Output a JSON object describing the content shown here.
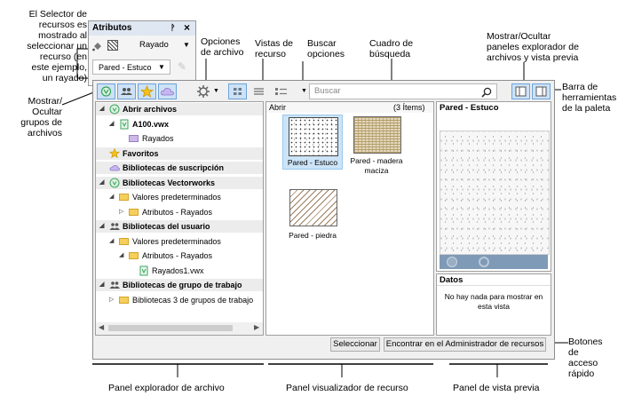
{
  "callouts": {
    "selector": [
      "El Selector de",
      "recursos es",
      "mostrado al",
      "seleccionar un",
      "recurso (en",
      "este ejemplo,",
      "un rayado)"
    ],
    "toggle_groups": [
      "Mostrar/",
      "Ocultar",
      "grupos de",
      "archivos"
    ],
    "file_options": [
      "Opciones",
      "de archivo"
    ],
    "resource_views": [
      "Vistas de",
      "recurso"
    ],
    "search_options": [
      "Buscar",
      "opciones"
    ],
    "search_box": [
      "Cuadro de",
      "búsqueda"
    ],
    "toggle_panels": [
      "Mostrar/Ocultar",
      "paneles explorador de",
      "archivos y vista previa"
    ],
    "toolbar": [
      "Barra de",
      "herramientas",
      "de la paleta"
    ],
    "quick_buttons": [
      "Botones",
      "de",
      "acceso",
      "rápido"
    ],
    "bottom_explorer": "Panel explorador de archivo",
    "bottom_viewer": "Panel visualizador de recurso",
    "bottom_preview": "Panel de vista previa"
  },
  "attributes_palette": {
    "title": "Atributos",
    "pin_glyph": "ᚹ",
    "close_glyph": "×",
    "fill_label": "Rayado",
    "resource_label": "Pared - Estuco"
  },
  "toolbar": {
    "search_placeholder": "Buscar"
  },
  "tree": [
    {
      "label": "Abrir archivos",
      "level": 0,
      "bold": true,
      "sec": true,
      "tri": "◢",
      "icon": "vw-icon"
    },
    {
      "label": "A100.vwx",
      "level": 1,
      "bold": true,
      "sec": false,
      "tri": "◢",
      "icon": "vw-file-icon"
    },
    {
      "label": "Rayados",
      "level": 2,
      "bold": false,
      "sec": false,
      "tri": "",
      "icon": "folder-purple"
    },
    {
      "label": "Favoritos",
      "level": 0,
      "bold": true,
      "sec": true,
      "tri": "",
      "icon": "star-icon"
    },
    {
      "label": "Bibliotecas de suscripción",
      "level": 0,
      "bold": true,
      "sec": true,
      "tri": "",
      "icon": "cloud-icon"
    },
    {
      "label": "Bibliotecas Vectorworks",
      "level": 0,
      "bold": true,
      "sec": true,
      "tri": "◢",
      "icon": "vw-icon"
    },
    {
      "label": "Valores predeterminados",
      "level": 1,
      "bold": false,
      "sec": false,
      "tri": "◢",
      "icon": "folder"
    },
    {
      "label": "Atributos - Rayados",
      "level": 2,
      "bold": false,
      "sec": false,
      "tri": "▷",
      "icon": "folder"
    },
    {
      "label": "Bibliotecas del usuario",
      "level": 0,
      "bold": true,
      "sec": true,
      "tri": "◢",
      "icon": "users-icon"
    },
    {
      "label": "Valores predeterminados",
      "level": 1,
      "bold": false,
      "sec": false,
      "tri": "◢",
      "icon": "folder"
    },
    {
      "label": "Atributos - Rayados",
      "level": 2,
      "bold": false,
      "sec": false,
      "tri": "◢",
      "icon": "folder"
    },
    {
      "label": "Rayados1.vwx",
      "level": 3,
      "bold": false,
      "sec": false,
      "tri": "",
      "icon": "vw-file-icon"
    },
    {
      "label": "Bibliotecas de grupo de trabajo",
      "level": 0,
      "bold": true,
      "sec": true,
      "tri": "◢",
      "icon": "users-icon"
    },
    {
      "label": "Bibliotecas 3 de grupos de trabajo",
      "level": 1,
      "bold": false,
      "sec": false,
      "tri": "▷",
      "icon": "folder"
    }
  ],
  "viewer": {
    "header": "Abrir",
    "count": "(3 Ítems)",
    "items": [
      {
        "label": "Pared - Estuco",
        "label2": "",
        "pattern": "stucco",
        "selected": true
      },
      {
        "label": "Pared - madera",
        "label2": "maciza",
        "pattern": "wood",
        "selected": false
      },
      {
        "label": "Pared - piedra",
        "label2": "",
        "pattern": "hatch",
        "selected": false
      }
    ]
  },
  "preview": {
    "title": "Pared - Estuco",
    "data_title": "Datos",
    "data_empty": "No hay nada para mostrar en esta vista"
  },
  "buttons": {
    "select": "Seleccionar",
    "find": "Encontrar en el Administrador de recursos"
  },
  "colors": {
    "accent_blue": "#2f63c0",
    "selection": "#cce4f7",
    "toolbar_active": "#cde2f6"
  }
}
